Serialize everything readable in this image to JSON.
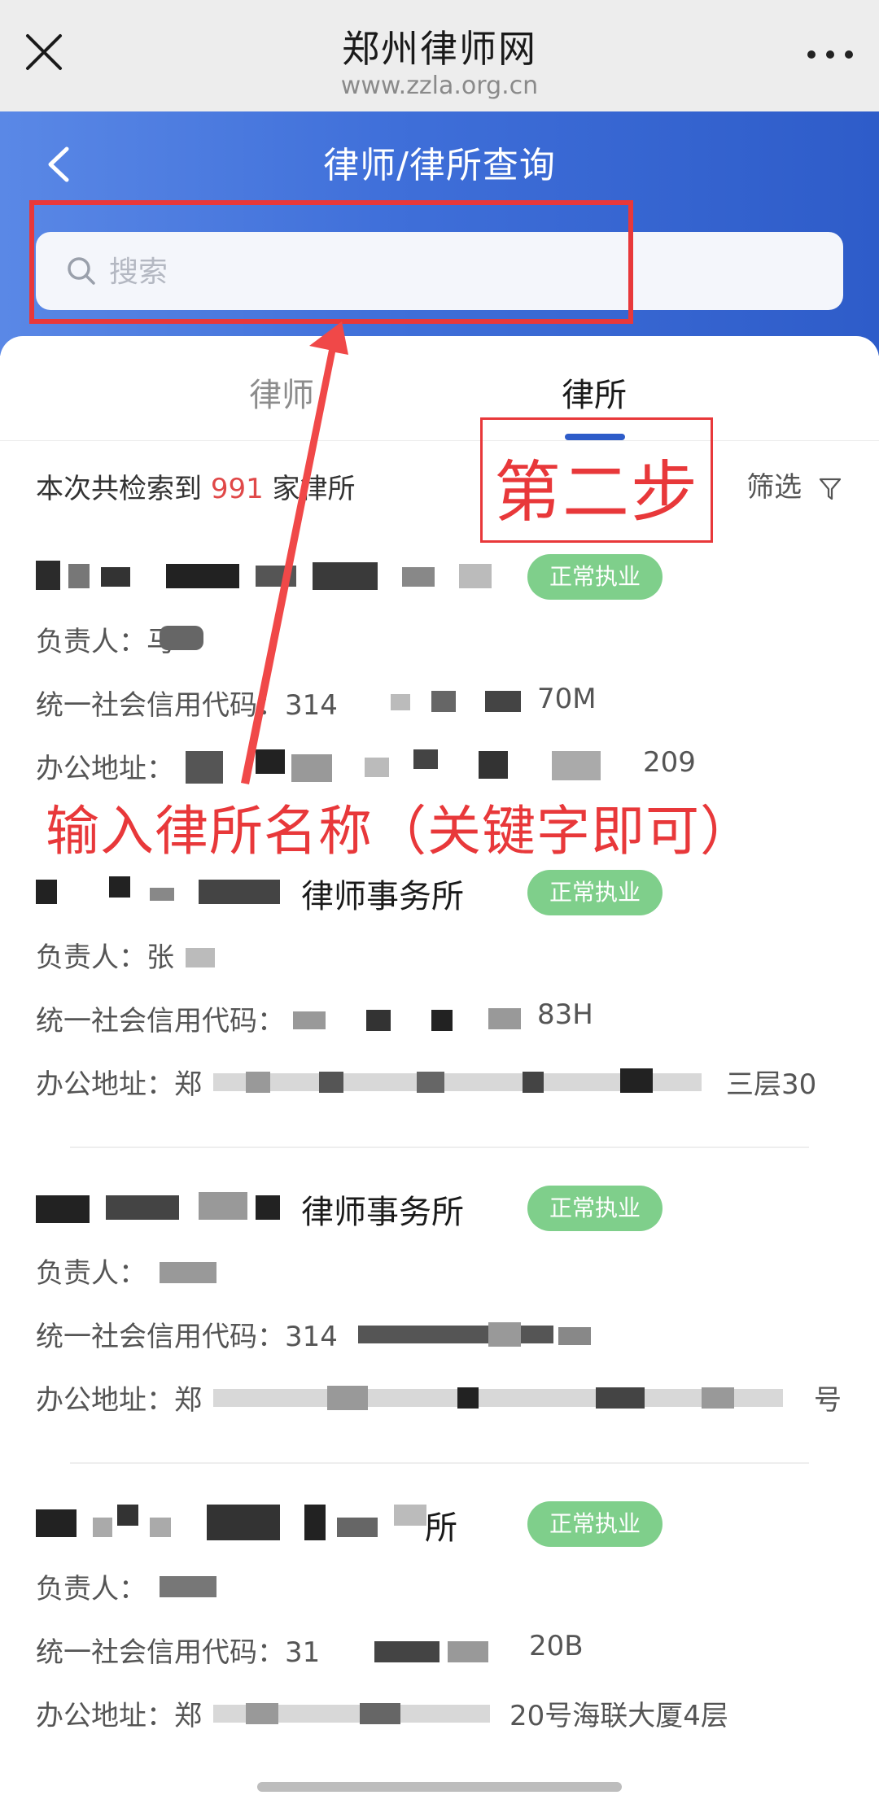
{
  "browser": {
    "title": "郑州律师网",
    "url": "www.zzla.org.cn"
  },
  "header": {
    "title": "律师/律所查询",
    "search_placeholder": "搜索"
  },
  "tabs": [
    {
      "label": "律师",
      "active": false
    },
    {
      "label": "律所",
      "active": true
    }
  ],
  "results": {
    "prefix": "本次共检索到",
    "count": "991",
    "suffix": "家律所",
    "filter_label": "筛选"
  },
  "annotations": {
    "step2": "第二步",
    "instruction": "输入律所名称（关键字即可）",
    "color": "#e8383a"
  },
  "items": [
    {
      "name": "",
      "status": "正常执业",
      "person_label": "负责人：",
      "person_value": "马",
      "code_label": "统一社会信用代码：",
      "code_value": "314",
      "code_tail": "70M",
      "address_label": "办公地址：",
      "address_value": "",
      "address_tail": "209"
    },
    {
      "name": "律师事务所",
      "status": "正常执业",
      "person_label": "负责人：",
      "person_value": "张",
      "code_label": "统一社会信用代码：",
      "code_value": "",
      "code_tail": "83H",
      "address_label": "办公地址：",
      "address_value": "郑",
      "address_tail": "三层30"
    },
    {
      "name": "律师事务所",
      "status": "正常执业",
      "person_label": "负责人：",
      "person_value": "",
      "code_label": "统一社会信用代码：",
      "code_value": "314",
      "code_tail": "",
      "address_label": "办公地址：",
      "address_value": "郑",
      "address_tail": "号"
    },
    {
      "name": "所",
      "status": "正常执业",
      "person_label": "负责人：",
      "person_value": "",
      "code_label": "统一社会信用代码：",
      "code_value": "31",
      "code_tail": "20B",
      "address_label": "办公地址：",
      "address_value": "郑",
      "address_tail": "20号海联大厦4层"
    }
  ]
}
